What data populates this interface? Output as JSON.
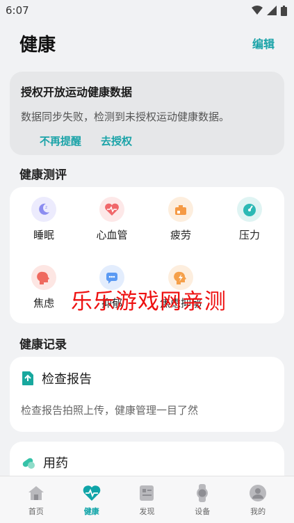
{
  "status_bar": {
    "time": "6:07"
  },
  "header": {
    "title": "健康",
    "edit_label": "编辑"
  },
  "auth_card": {
    "title": "授权开放运动健康数据",
    "description": "数据同步失败，检测到未授权运动健康数据。",
    "dismiss_label": "不再提醒",
    "authorize_label": "去授权"
  },
  "evaluation": {
    "section_title": "健康测评",
    "items": [
      {
        "label": "睡眠",
        "icon": "moon-icon",
        "color": "#8b8cf0"
      },
      {
        "label": "心血管",
        "icon": "heart-icon",
        "color": "#f0676a"
      },
      {
        "label": "疲劳",
        "icon": "battery-icon",
        "color": "#f59a45"
      },
      {
        "label": "压力",
        "icon": "gauge-icon",
        "color": "#2cb9b5"
      },
      {
        "label": "焦虑",
        "icon": "head-icon",
        "color": "#ef6a5f"
      },
      {
        "label": "抑郁",
        "icon": "chat-icon",
        "color": "#5b9af3"
      },
      {
        "label": "焦虑抑郁",
        "icon": "bolt-icon",
        "color": "#f5a04a"
      }
    ]
  },
  "watermark": "乐乐游戏网亲测",
  "records": {
    "section_title": "健康记录",
    "report": {
      "title": "检查报告",
      "description": "检查报告拍照上传，健康管理一目了然",
      "icon": "report-icon"
    },
    "medication": {
      "title": "用药",
      "icon": "pill-icon"
    }
  },
  "bottom_nav": {
    "items": [
      {
        "label": "首页",
        "icon": "home-icon"
      },
      {
        "label": "健康",
        "icon": "health-heart-icon",
        "active": true
      },
      {
        "label": "发现",
        "icon": "discover-icon"
      },
      {
        "label": "设备",
        "icon": "watch-icon"
      },
      {
        "label": "我的",
        "icon": "profile-icon"
      }
    ],
    "active_color": "#0fa4a8"
  }
}
